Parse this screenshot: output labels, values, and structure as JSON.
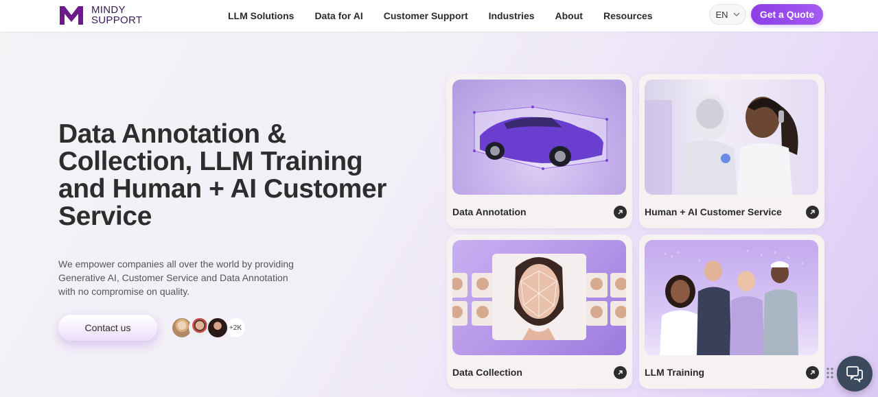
{
  "header": {
    "logo_line1": "MINDY",
    "logo_line2": "SUPPORT",
    "nav": [
      "LLM Solutions",
      "Data for AI",
      "Customer Support",
      "Industries",
      "About",
      "Resources"
    ],
    "language": "EN",
    "quote_label": "Get a Quote"
  },
  "hero": {
    "title": "Data Annotation & Collection, LLM Training and Human + AI Customer Service",
    "subtitle": "We empower companies all over the world by providing Generative AI, Customer Service and Data Annotation with no compromise on quality.",
    "contact_label": "Contact us",
    "avatar_count": "+2K"
  },
  "cards": [
    {
      "label": "Data Annotation"
    },
    {
      "label": "Human + AI Customer Service"
    },
    {
      "label": "Data Collection"
    },
    {
      "label": "LLM Training"
    }
  ],
  "colors": {
    "accent": "#8b3ee6",
    "logo": "#3a1a55",
    "chat_fab": "#3b4a5c"
  },
  "icons": {
    "card_arrow": "arrow-up-right-icon",
    "chat": "chat-bubble-icon",
    "lang_chevron": "chevron-down-icon"
  }
}
